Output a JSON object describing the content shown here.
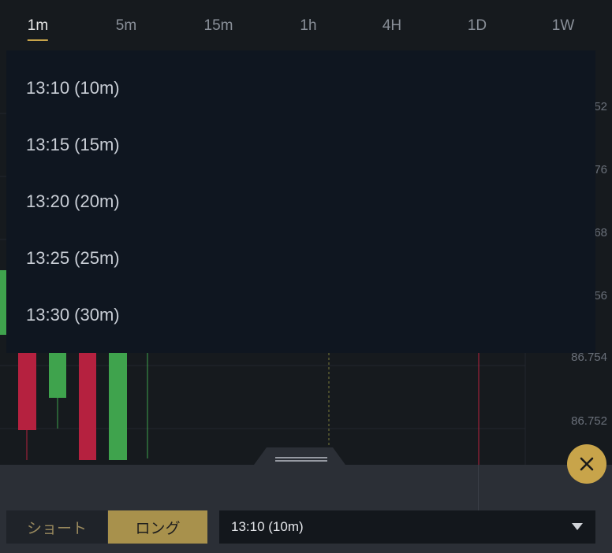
{
  "timeframes": [
    "1m",
    "5m",
    "15m",
    "1h",
    "4H",
    "1D",
    "1W"
  ],
  "active_timeframe": "1m",
  "price_axis": {
    "partial_labels": [
      "52",
      "76",
      "68",
      "56"
    ],
    "labels": [
      "86.754",
      "86.752"
    ]
  },
  "dropdown": {
    "options": [
      "13:10 (10m)",
      "13:15 (15m)",
      "13:20 (20m)",
      "13:25 (25m)",
      "13:30 (30m)"
    ]
  },
  "trade_panel": {
    "short_label": "ショート",
    "long_label": "ロング",
    "selected_expiry": "13:10 (10m)"
  },
  "colors": {
    "accent": "#c8a44a",
    "bull": "#3fa34d",
    "bear": "#b5213f"
  },
  "icons": {
    "close": "close-icon",
    "caret": "caret-down-icon",
    "handle": "drag-handle-icon"
  }
}
